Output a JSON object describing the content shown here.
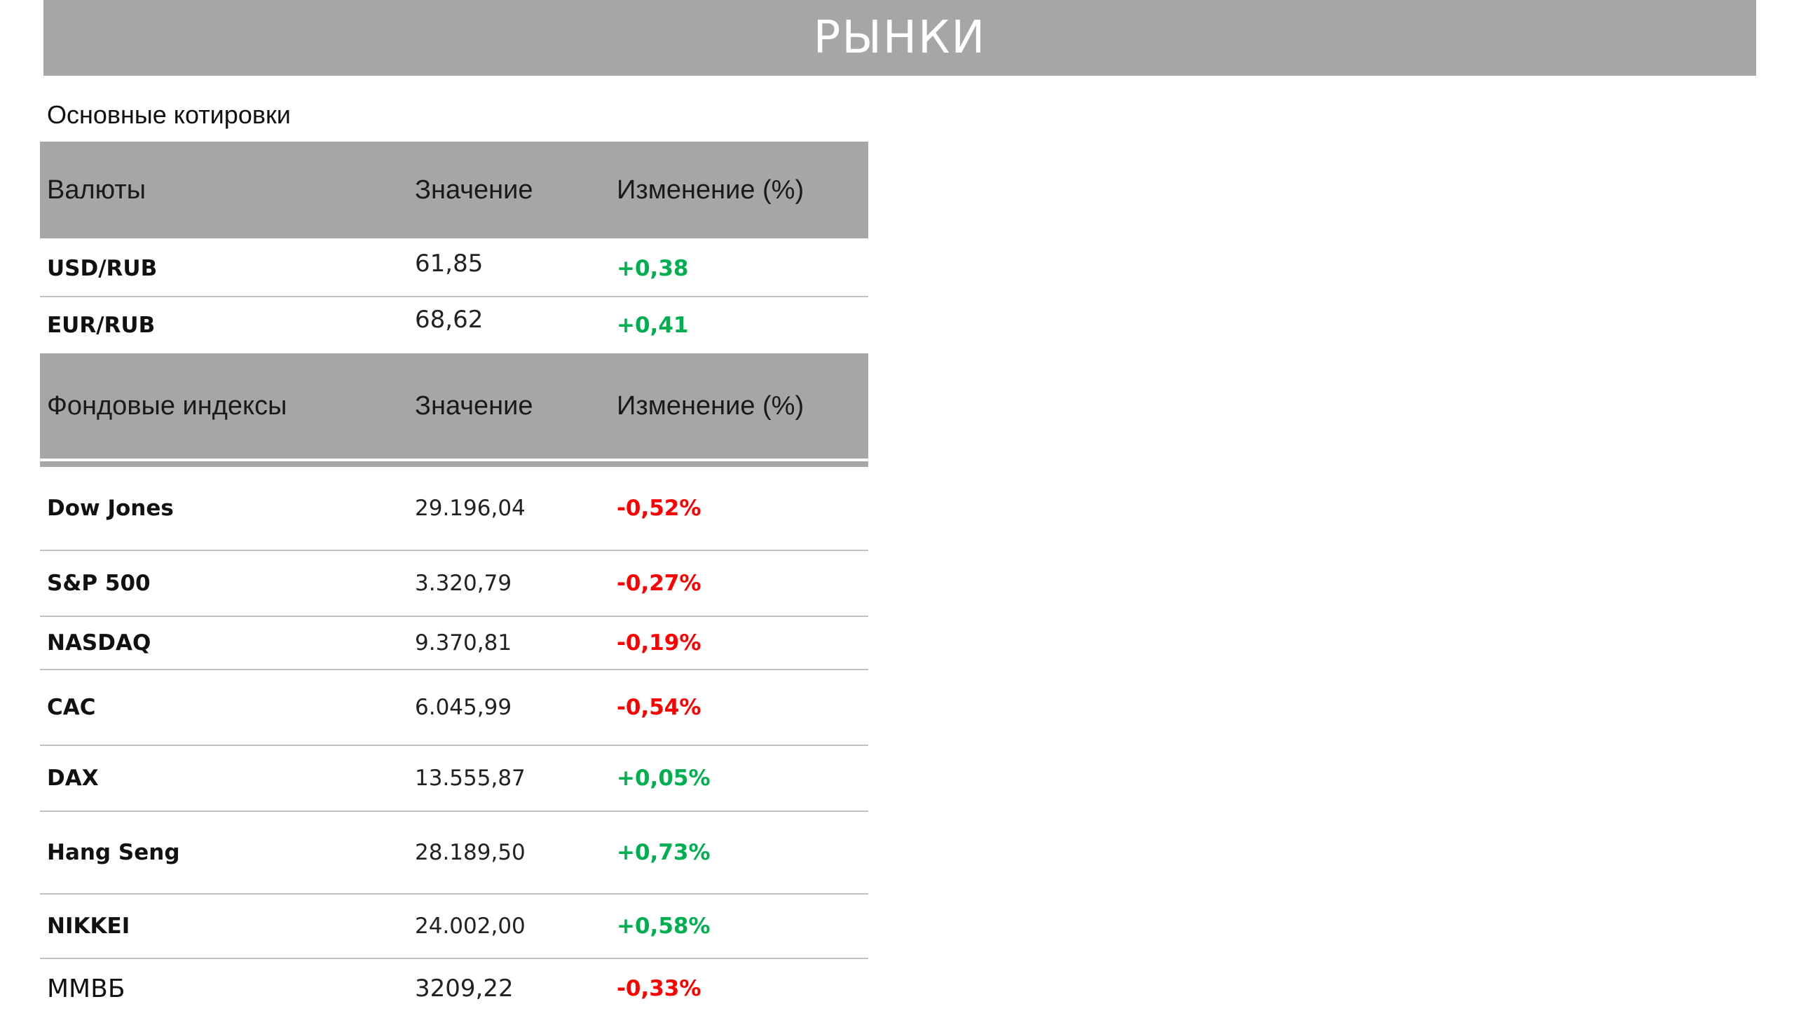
{
  "header": {
    "title": "РЫНКИ"
  },
  "section_title": "Основные котировки",
  "colors": {
    "positive": "#00b050",
    "negative": "#ff0000",
    "header_bg": "#a6a6a6"
  },
  "currencies": {
    "header": [
      "Валюты",
      "Значение",
      "Изменение (%)"
    ],
    "rows": [
      {
        "name": "USD/RUB",
        "value": "61,85",
        "change": "+0,38",
        "direction": "positive"
      },
      {
        "name": "EUR/RUB",
        "value": "68,62",
        "change": "+0,41",
        "direction": "positive"
      }
    ]
  },
  "indexes": {
    "header": [
      "Фондовые индексы",
      "Значение",
      "Изменение (%)"
    ],
    "rows": [
      {
        "name": "Dow Jones",
        "value": "29.196,04",
        "change": "-0,52%",
        "direction": "negative"
      },
      {
        "name": "S&P 500",
        "value": "3.320,79",
        "change": "-0,27%",
        "direction": "negative"
      },
      {
        "name": "NASDAQ",
        "value": "9.370,81",
        "change": "-0,19%",
        "direction": "negative"
      },
      {
        "name": "CAC",
        "value": "6.045,99",
        "change": "-0,54%",
        "direction": "negative"
      },
      {
        "name": "DAX",
        "value": "13.555,87",
        "change": "+0,05%",
        "direction": "positive"
      },
      {
        "name": "Hang Seng",
        "value": "28.189,50",
        "change": "+0,73%",
        "direction": "positive"
      },
      {
        "name": "NIKKEI",
        "value": "24.002,00",
        "change": "+0,58%",
        "direction": "positive"
      },
      {
        "name": "ММВБ",
        "value": "3209,22",
        "change": "-0,33%",
        "direction": "negative"
      }
    ]
  }
}
